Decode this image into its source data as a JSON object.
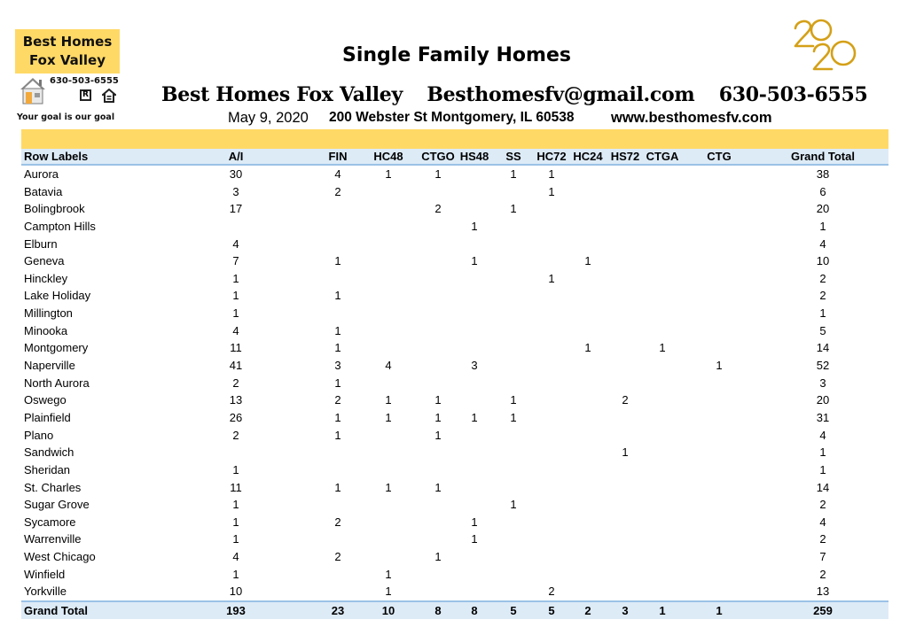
{
  "logo": {
    "line1": "Best Homes",
    "line2": "Fox Valley",
    "phone": "630-503-6555",
    "realtor_mark": "R",
    "tagline": "Your goal is our goal",
    "icons": [
      "house-icon",
      "realtor-icon",
      "equal-housing-icon"
    ],
    "accent_color": "#FFD966"
  },
  "header": {
    "title": "Single Family Homes",
    "company": "Best Homes Fox Valley",
    "email": "Besthomesfv@gmail.com",
    "phone": "630-503-6555",
    "date": "May 9, 2020",
    "address": "200 Webster St Montgomery, IL 60538",
    "website": "www.besthomesfv.com",
    "year_badge": "2020",
    "year_badge_color": "#D4A017"
  },
  "table": {
    "band_color": "#FFD966",
    "header_color": "#DDEBF7",
    "border_color": "#9BC2E6",
    "row_label_header": "Row Labels",
    "columns": [
      "A/I",
      "FIN",
      "HC48",
      "CTGO",
      "HS48",
      "SS",
      "HC72",
      "HC24",
      "HS72",
      "CTGA",
      "CTG",
      "Grand Total"
    ],
    "rows": [
      {
        "label": "Aurora",
        "values": [
          "30",
          "4",
          "1",
          "1",
          "",
          "1",
          "1",
          "",
          "",
          "",
          "",
          "38"
        ]
      },
      {
        "label": "Batavia",
        "values": [
          "3",
          "2",
          "",
          "",
          "",
          "",
          "1",
          "",
          "",
          "",
          "",
          "6"
        ]
      },
      {
        "label": "Bolingbrook",
        "values": [
          "17",
          "",
          "",
          "2",
          "",
          "1",
          "",
          "",
          "",
          "",
          "",
          "20"
        ]
      },
      {
        "label": "Campton Hills",
        "values": [
          "",
          "",
          "",
          "",
          "1",
          "",
          "",
          "",
          "",
          "",
          "",
          "1"
        ]
      },
      {
        "label": "Elburn",
        "values": [
          "4",
          "",
          "",
          "",
          "",
          "",
          "",
          "",
          "",
          "",
          "",
          "4"
        ]
      },
      {
        "label": "Geneva",
        "values": [
          "7",
          "1",
          "",
          "",
          "1",
          "",
          "",
          "1",
          "",
          "",
          "",
          "10"
        ]
      },
      {
        "label": "Hinckley",
        "values": [
          "1",
          "",
          "",
          "",
          "",
          "",
          "1",
          "",
          "",
          "",
          "",
          "2"
        ]
      },
      {
        "label": "Lake Holiday",
        "values": [
          "1",
          "1",
          "",
          "",
          "",
          "",
          "",
          "",
          "",
          "",
          "",
          "2"
        ]
      },
      {
        "label": "Millington",
        "values": [
          "1",
          "",
          "",
          "",
          "",
          "",
          "",
          "",
          "",
          "",
          "",
          "1"
        ]
      },
      {
        "label": "Minooka",
        "values": [
          "4",
          "1",
          "",
          "",
          "",
          "",
          "",
          "",
          "",
          "",
          "",
          "5"
        ]
      },
      {
        "label": "Montgomery",
        "values": [
          "11",
          "1",
          "",
          "",
          "",
          "",
          "",
          "1",
          "",
          "1",
          "",
          "14"
        ]
      },
      {
        "label": "Naperville",
        "values": [
          "41",
          "3",
          "4",
          "",
          "3",
          "",
          "",
          "",
          "",
          "",
          "1",
          "52"
        ]
      },
      {
        "label": "North Aurora",
        "values": [
          "2",
          "1",
          "",
          "",
          "",
          "",
          "",
          "",
          "",
          "",
          "",
          "3"
        ]
      },
      {
        "label": "Oswego",
        "values": [
          "13",
          "2",
          "1",
          "1",
          "",
          "1",
          "",
          "",
          "2",
          "",
          "",
          "20"
        ]
      },
      {
        "label": "Plainfield",
        "values": [
          "26",
          "1",
          "1",
          "1",
          "1",
          "1",
          "",
          "",
          "",
          "",
          "",
          "31"
        ]
      },
      {
        "label": "Plano",
        "values": [
          "2",
          "1",
          "",
          "1",
          "",
          "",
          "",
          "",
          "",
          "",
          "",
          "4"
        ]
      },
      {
        "label": "Sandwich",
        "values": [
          "",
          "",
          "",
          "",
          "",
          "",
          "",
          "",
          "1",
          "",
          "",
          "1"
        ]
      },
      {
        "label": "Sheridan",
        "values": [
          "1",
          "",
          "",
          "",
          "",
          "",
          "",
          "",
          "",
          "",
          "",
          "1"
        ]
      },
      {
        "label": "St. Charles",
        "values": [
          "11",
          "1",
          "1",
          "1",
          "",
          "",
          "",
          "",
          "",
          "",
          "",
          "14"
        ]
      },
      {
        "label": "Sugar Grove",
        "values": [
          "1",
          "",
          "",
          "",
          "",
          "1",
          "",
          "",
          "",
          "",
          "",
          "2"
        ]
      },
      {
        "label": "Sycamore",
        "values": [
          "1",
          "2",
          "",
          "",
          "1",
          "",
          "",
          "",
          "",
          "",
          "",
          "4"
        ]
      },
      {
        "label": "Warrenville",
        "values": [
          "1",
          "",
          "",
          "",
          "1",
          "",
          "",
          "",
          "",
          "",
          "",
          "2"
        ]
      },
      {
        "label": "West Chicago",
        "values": [
          "4",
          "2",
          "",
          "1",
          "",
          "",
          "",
          "",
          "",
          "",
          "",
          "7"
        ]
      },
      {
        "label": "Winfield",
        "values": [
          "1",
          "",
          "1",
          "",
          "",
          "",
          "",
          "",
          "",
          "",
          "",
          "2"
        ]
      },
      {
        "label": "Yorkville",
        "values": [
          "10",
          "",
          "1",
          "",
          "",
          "",
          "2",
          "",
          "",
          "",
          "",
          "13"
        ]
      }
    ],
    "total": {
      "label": "Grand Total",
      "values": [
        "193",
        "23",
        "10",
        "8",
        "8",
        "5",
        "5",
        "2",
        "3",
        "1",
        "1",
        "259"
      ]
    }
  }
}
